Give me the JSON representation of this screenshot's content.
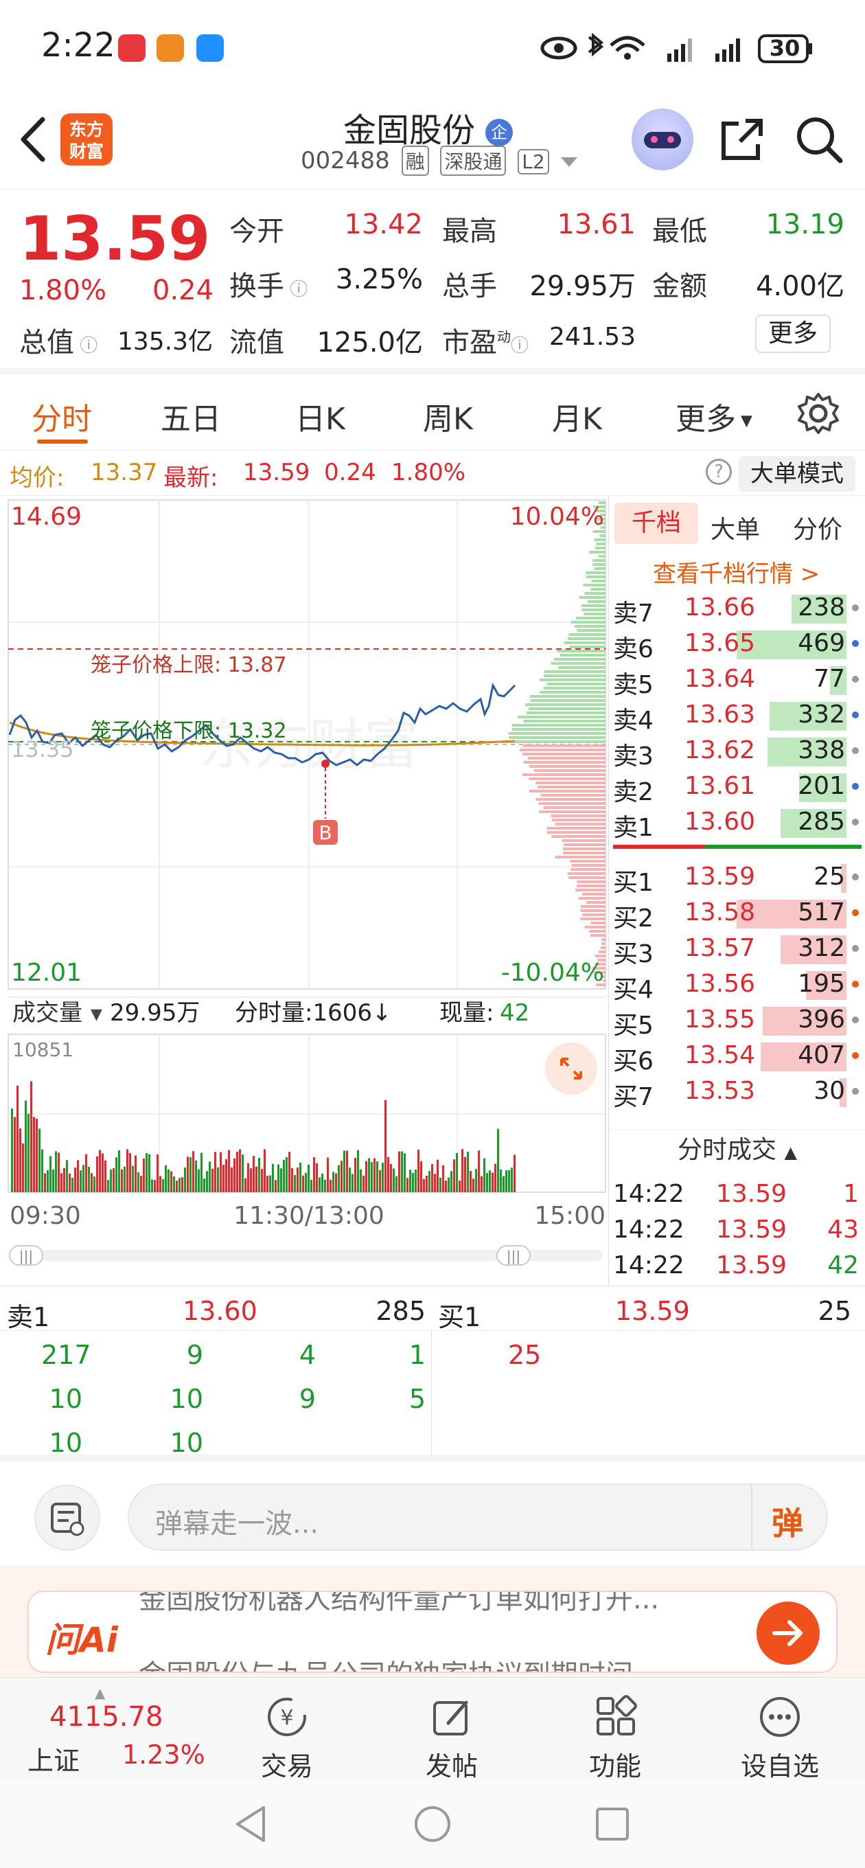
{
  "status": {
    "time": "2:22",
    "battery": "30"
  },
  "header": {
    "logo_line1": "东方",
    "logo_line2": "财富",
    "stock_name": "金固股份",
    "badge": "企",
    "code": "002488",
    "tags": [
      "融",
      "深股通",
      "L2"
    ]
  },
  "quote": {
    "price": "13.59",
    "change_pct": "1.80%",
    "change": "0.24",
    "open_label": "今开",
    "open": "13.42",
    "high_label": "最高",
    "high": "13.61",
    "low_label": "最低",
    "low": "13.19",
    "turnover_label": "换手",
    "turnover": "3.25%",
    "volume_label": "总手",
    "volume": "29.95万",
    "amount_label": "金额",
    "amount": "4.00亿",
    "mktcap_label": "总值",
    "mktcap": "135.3亿",
    "float_label": "流值",
    "float": "125.0亿",
    "pe_label": "市盈",
    "pe_sup": "动",
    "pe": "241.53",
    "more": "更多"
  },
  "tabs": [
    "分时",
    "五日",
    "日K",
    "周K",
    "月K",
    "更多"
  ],
  "avg_row": {
    "avg_label": "均价:",
    "avg": "13.37",
    "latest_label": "最新:",
    "latest": "13.59",
    "chg": "0.24",
    "pct": "1.80%",
    "big_mode": "大单模式"
  },
  "chart": {
    "y_top": "14.69",
    "y_top_pct": "10.04%",
    "y_bottom": "12.01",
    "y_bottom_pct": "-10.04%",
    "y_mid": "13.35",
    "cage_upper": "笼子价格上限: 13.87",
    "cage_lower": "笼子价格下限: 13.32",
    "b_marker": "B",
    "watermark": "东方财富",
    "vol_label": "成交量",
    "vol_total": "29.95万",
    "tick_label": "分时量:1606↓",
    "now_label": "现量:",
    "now_val": "42",
    "vol_max": "10851",
    "time_start": "09:30",
    "time_mid": "11:30/13:00",
    "time_end": "15:00"
  },
  "chart_data": {
    "type": "line",
    "title": "",
    "x": [
      "09:30",
      "11:30/13:00",
      "15:00"
    ],
    "ylim": [
      12.01,
      14.69
    ],
    "series": [],
    "reference_lines": [
      {
        "label": "笼子价格上限",
        "value": 13.87
      },
      {
        "label": "笼子价格下限",
        "value": 13.32
      }
    ]
  },
  "right_panel": {
    "tabs": [
      "千档",
      "大单",
      "分价"
    ],
    "view_all": "查看千档行情 >",
    "asks": [
      {
        "label": "卖7",
        "price": "13.66",
        "vol": "238",
        "frac": 0.5
      },
      {
        "label": "卖6",
        "price": "13.65",
        "vol": "469",
        "frac": 1.0
      },
      {
        "label": "卖5",
        "price": "13.64",
        "vol": "77",
        "frac": 0.15
      },
      {
        "label": "卖4",
        "price": "13.63",
        "vol": "332",
        "frac": 0.7
      },
      {
        "label": "卖3",
        "price": "13.62",
        "vol": "338",
        "frac": 0.72
      },
      {
        "label": "卖2",
        "price": "13.61",
        "vol": "201",
        "frac": 0.43
      },
      {
        "label": "卖1",
        "price": "13.60",
        "vol": "285",
        "frac": 0.6
      }
    ],
    "bids": [
      {
        "label": "买1",
        "price": "13.59",
        "vol": "25",
        "frac": 0.05
      },
      {
        "label": "买2",
        "price": "13.58",
        "vol": "517",
        "frac": 1.0
      },
      {
        "label": "买3",
        "price": "13.57",
        "vol": "312",
        "frac": 0.6
      },
      {
        "label": "买4",
        "price": "13.56",
        "vol": "195",
        "frac": 0.37
      },
      {
        "label": "买5",
        "price": "13.55",
        "vol": "396",
        "frac": 0.76
      },
      {
        "label": "买6",
        "price": "13.54",
        "vol": "407",
        "frac": 0.78
      },
      {
        "label": "买7",
        "price": "13.53",
        "vol": "30",
        "frac": 0.06
      }
    ],
    "ticks_title": "分时成交",
    "ticks": [
      {
        "time": "14:22",
        "price": "13.59",
        "vol": "1"
      },
      {
        "time": "14:22",
        "price": "13.59",
        "vol": "43"
      },
      {
        "time": "14:22",
        "price": "13.59",
        "vol": "42"
      }
    ]
  },
  "level1": {
    "sell_label": "卖1",
    "sell_price": "13.60",
    "sell_total": "285",
    "buy_label": "买1",
    "buy_price": "13.59",
    "buy_total": "25",
    "sell_orders": [
      "217",
      "9",
      "4",
      "1",
      "10",
      "10",
      "9",
      "5",
      "10",
      "10"
    ],
    "buy_orders": [
      "25"
    ]
  },
  "barrage": {
    "placeholder": "弹幕走一波...",
    "send": "弹"
  },
  "ai": {
    "brand": "问Ai",
    "line1": "金固股份机器人结构件量产订单如何打开...",
    "line2": "金固股份与九号公司的独家协议到期时间"
  },
  "bottom_nav": {
    "index_value": "4115.78",
    "index_name": "上证",
    "index_pct": "1.23%",
    "items": [
      "交易",
      "发帖",
      "功能",
      "设自选"
    ]
  },
  "colors": {
    "up": "#e0282e",
    "down": "#1a9a2a",
    "accent": "#e85a0c",
    "avg_line": "#d38a12",
    "price_line": "#2a5fa8"
  }
}
